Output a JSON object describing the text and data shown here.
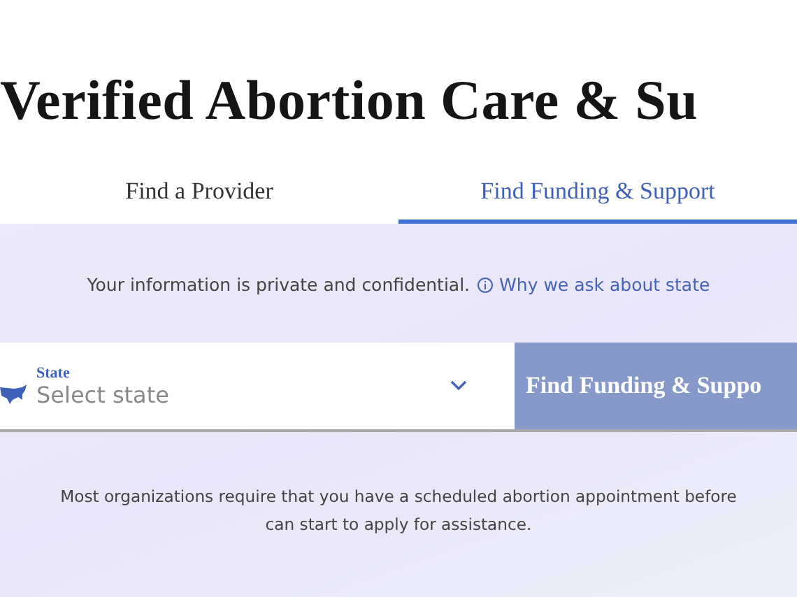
{
  "title": "Verified Abortion Care & Su",
  "tabs": [
    {
      "label": "Find a Provider",
      "selected": false
    },
    {
      "label": "Find Funding & Support",
      "selected": true
    }
  ],
  "notice": {
    "text": "Your information is private and confidential.",
    "link": "Why we ask about state"
  },
  "state_field": {
    "label": "State",
    "placeholder": "Select state"
  },
  "submit_button": "Find Funding & Suppo",
  "note_lines": [
    "Most organizations require that you have a scheduled abortion appointment before",
    "can start to apply for assistance."
  ]
}
